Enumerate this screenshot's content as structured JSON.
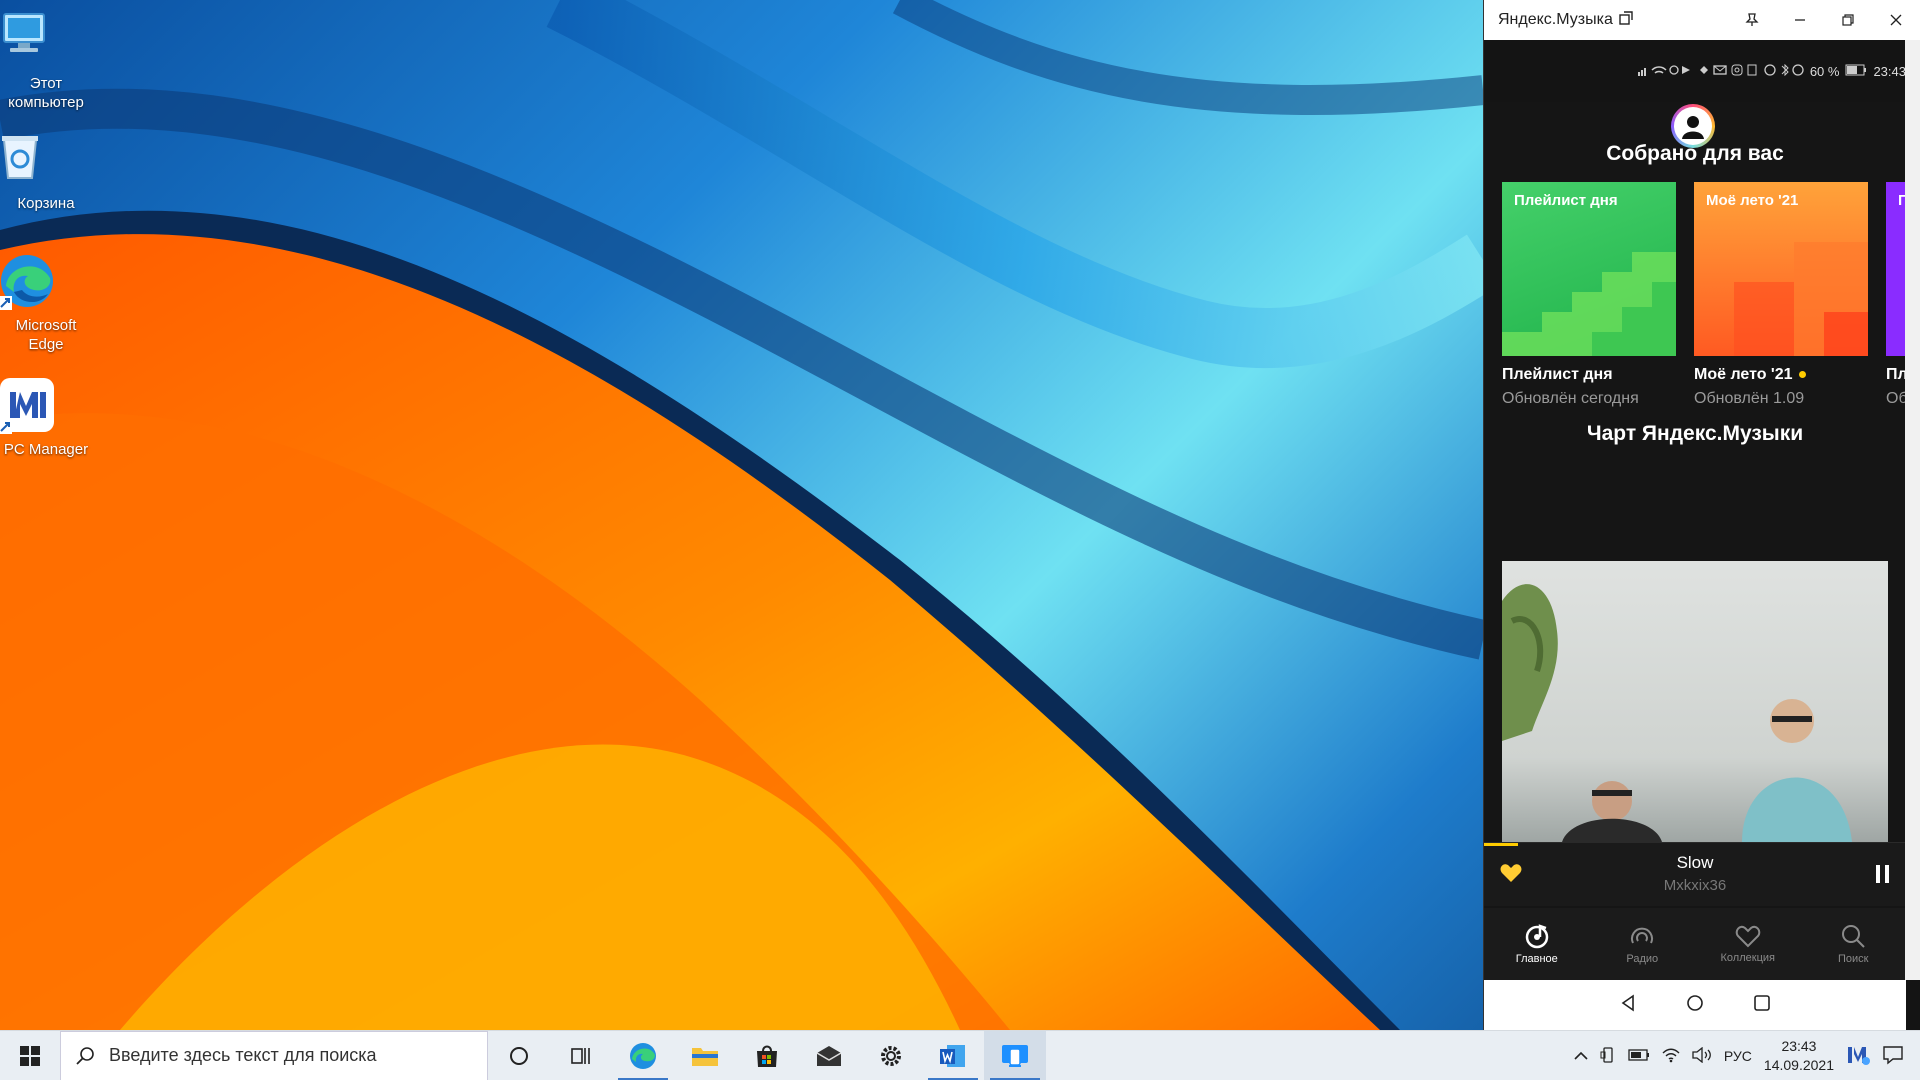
{
  "desktop": {
    "icons": [
      {
        "label": "Этот компьютер",
        "icon": "computer-icon"
      },
      {
        "label": "Корзина",
        "icon": "recycle-bin-icon"
      },
      {
        "label": "Microsoft Edge",
        "icon": "edge-icon"
      },
      {
        "label": "PC Manager",
        "icon": "pc-manager-icon"
      }
    ]
  },
  "phone_window": {
    "title": "Яндекс.Музыка",
    "status": {
      "battery": "60 %",
      "time": "23:43"
    }
  },
  "app": {
    "section1_title": "Собрано для вас",
    "cards": [
      {
        "cover_label": "Плейлист дня",
        "name": "Плейлист дня",
        "subtitle": "Обновлён сегодня"
      },
      {
        "cover_label": "Моё лето '21",
        "name": "Моё лето '21",
        "subtitle": "Обновлён 1.09"
      },
      {
        "cover_label": "П с",
        "name": "Пл",
        "subtitle": "Об"
      }
    ],
    "section2_title": "Чарт Яндекс.Музыки",
    "player": {
      "track": "Slow",
      "artist": "Mxkxix36",
      "progress": 0.08
    },
    "nav": [
      {
        "label": "Главное",
        "icon": "home-music-icon"
      },
      {
        "label": "Радио",
        "icon": "radio-icon"
      },
      {
        "label": "Коллекция",
        "icon": "heart-icon"
      },
      {
        "label": "Поиск",
        "icon": "search-icon"
      }
    ]
  },
  "taskbar": {
    "search_placeholder": "Введите здесь текст для поиска",
    "language": "РУС",
    "time": "23:43",
    "date": "14.09.2021"
  },
  "colors": {
    "accent": "#ffcc00",
    "orange": "#ff6a00",
    "blue": "#1f86d8"
  }
}
